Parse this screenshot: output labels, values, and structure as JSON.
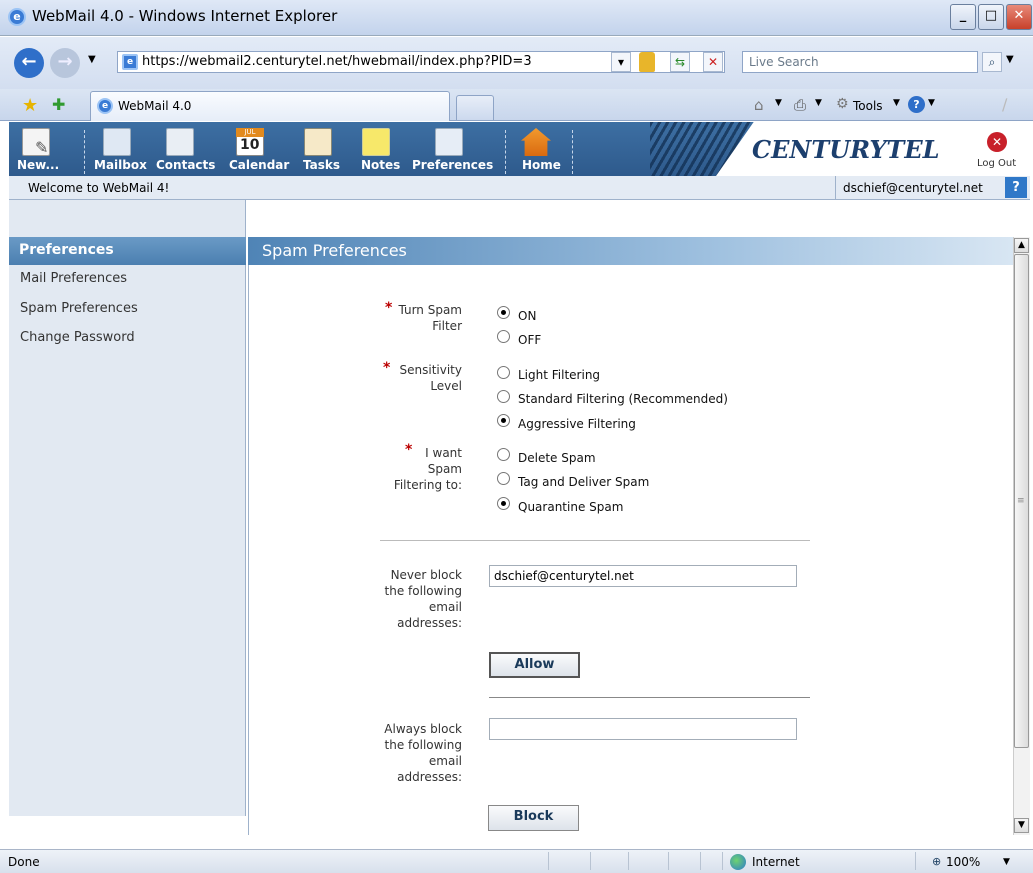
{
  "window": {
    "title": "WebMail 4.0 - Windows Internet Explorer"
  },
  "browser": {
    "url": "https://webmail2.centurytel.net/hwebmail/index.php?PID=3",
    "search_placeholder": "Live Search",
    "tab_label": "WebMail 4.0",
    "tools_label": "Tools",
    "status_text": "Done",
    "zone_label": "Internet",
    "zoom": "100%"
  },
  "app": {
    "toolbar": [
      "New...",
      "Mailbox",
      "Contacts",
      "Calendar",
      "Tasks",
      "Notes",
      "Preferences",
      "Home"
    ],
    "brand": "CENTURYTEL",
    "logout": "Log Out",
    "welcome": "Welcome to WebMail 4!",
    "user_email": "dschief@centurytel.net",
    "help": "?",
    "calendar_icon_month": "JUL",
    "calendar_icon_day": "10"
  },
  "sidebar": {
    "heading": "Preferences",
    "items": [
      "Mail Preferences",
      "Spam Preferences",
      "Change Password"
    ]
  },
  "main": {
    "heading": "Spam Preferences",
    "filter_label": [
      "Turn Spam",
      "Filter"
    ],
    "filter_options": [
      "ON",
      "OFF"
    ],
    "filter_selected": "ON",
    "sensitivity_label": [
      "Sensitivity",
      "Level"
    ],
    "sensitivity_options": [
      "Light Filtering",
      "Standard Filtering (Recommended)",
      "Aggressive Filtering"
    ],
    "sensitivity_selected": "Aggressive Filtering",
    "action_label": [
      "I want",
      "Spam",
      "Filtering to:"
    ],
    "action_options": [
      "Delete Spam",
      "Tag and Deliver Spam",
      "Quarantine Spam"
    ],
    "action_selected": "Quarantine Spam",
    "never_block_label": [
      "Never block",
      "the following",
      "email",
      "addresses:"
    ],
    "never_block_value": "dschief@centurytel.net",
    "allow_button": "Allow",
    "always_block_label": [
      "Always block",
      "the following",
      "email",
      "addresses:"
    ],
    "always_block_value": "",
    "block_button": "Block"
  },
  "colors": {
    "toolbar": "#2e5a8c",
    "required": "#bb0000",
    "brand": "#1c3f6e"
  }
}
